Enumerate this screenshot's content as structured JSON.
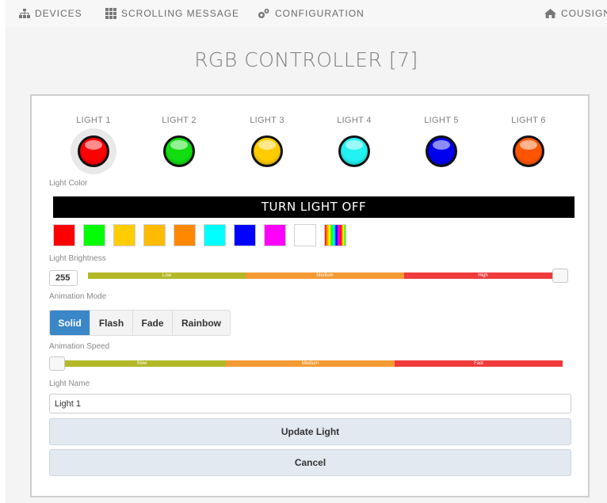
{
  "nav": {
    "devices": "DEVICES",
    "scrolling_message": "SCROLLING MESSAGE",
    "configuration": "CONFIGURATION",
    "home": "COUSIGN"
  },
  "title": "RGB CONTROLLER [7]",
  "lights": [
    {
      "label": "LIGHT 1",
      "color": "#ff0000",
      "active": true
    },
    {
      "label": "LIGHT 2",
      "color": "#11dd11",
      "active": false
    },
    {
      "label": "LIGHT 3",
      "color": "#ffcc00",
      "active": false
    },
    {
      "label": "LIGHT 4",
      "color": "#22f2f2",
      "active": false
    },
    {
      "label": "LIGHT 5",
      "color": "#0000ee",
      "active": false
    },
    {
      "label": "LIGHT 6",
      "color": "#ff5500",
      "active": false
    }
  ],
  "light_color": {
    "label": "Light Color",
    "off_button": "TURN LIGHT OFF",
    "swatches": [
      "#ff0000",
      "#00ff00",
      "#ffcc00",
      "#ffbb00",
      "#ff8800",
      "#00ffff",
      "#0000ff",
      "#ff00ff",
      "#ffffff",
      "rainbow"
    ]
  },
  "brightness": {
    "label": "Light Brightness",
    "value": "255",
    "segments": [
      "Low",
      "Medium",
      "High"
    ],
    "level": 1.0
  },
  "animation_mode": {
    "label": "Animation Mode",
    "options": [
      "Solid",
      "Flash",
      "Fade",
      "Rainbow"
    ],
    "selected": "Solid"
  },
  "animation_speed": {
    "label": "Animation Speed",
    "segments": [
      "Slow",
      "Medium",
      "Fast"
    ],
    "level": 0.0
  },
  "light_name": {
    "label": "Light Name",
    "value": "Light 1"
  },
  "buttons": {
    "update": "Update Light",
    "cancel": "Cancel"
  },
  "colors": {
    "accent": "#3a87c8",
    "slider_low": "#b3b826",
    "slider_medium": "#f39a33",
    "slider_high": "#ef3b3b"
  }
}
